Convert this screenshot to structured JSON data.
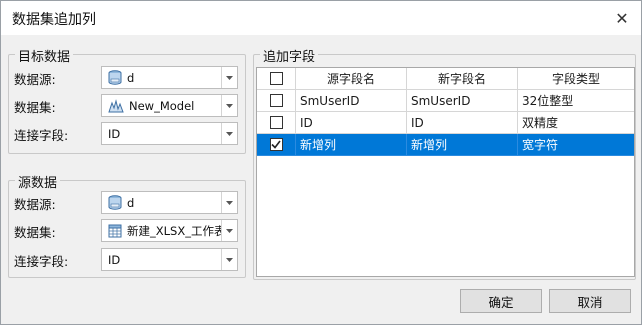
{
  "dialog": {
    "title": "数据集追加列",
    "close_glyph": "✕"
  },
  "target": {
    "legend": "目标数据",
    "datasource_label": "数据源:",
    "datasource_value": "d",
    "dataset_label": "数据集:",
    "dataset_value": "New_Model",
    "join_field_label": "连接字段:",
    "join_field_value": "ID"
  },
  "source": {
    "legend": "源数据",
    "datasource_label": "数据源:",
    "datasource_value": "d",
    "dataset_label": "数据集:",
    "dataset_value": "新建_XLSX_工作表",
    "join_field_label": "连接字段:",
    "join_field_value": "ID"
  },
  "append_fields": {
    "legend": "追加字段",
    "columns": [
      "源字段名",
      "新字段名",
      "字段类型"
    ],
    "rows": [
      {
        "checked": false,
        "source_field": "SmUserID",
        "new_field": "SmUserID",
        "field_type": "32位整型",
        "selected": false
      },
      {
        "checked": false,
        "source_field": "ID",
        "new_field": "ID",
        "field_type": "双精度",
        "selected": false
      },
      {
        "checked": true,
        "source_field": "新增列",
        "new_field": "新增列",
        "field_type": "宽字符",
        "selected": true
      }
    ]
  },
  "buttons": {
    "ok_label": "确定",
    "cancel_label": "取消"
  },
  "colors": {
    "selection": "#0078d7",
    "window_bg": "#f0f0f0"
  },
  "icons": {
    "datasource": "database-icon",
    "target_dataset": "model-dataset-icon",
    "source_dataset": "table-dataset-icon",
    "dropdown": "chevron-down-icon",
    "checkmark": "checkmark-icon"
  }
}
